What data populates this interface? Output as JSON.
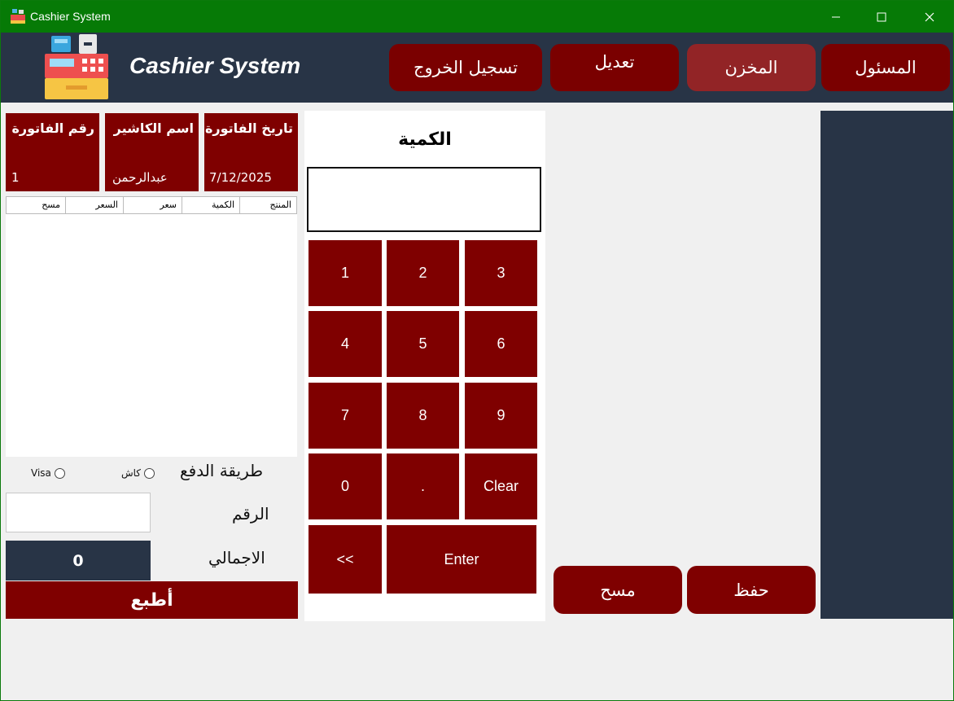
{
  "window": {
    "title": "Cashier System"
  },
  "header": {
    "brand": "Cashier System",
    "nav": [
      {
        "label": "تسجيل الخروج"
      },
      {
        "label": "تعديل"
      },
      {
        "label": "المخزن"
      },
      {
        "label": "المسئول"
      }
    ]
  },
  "invoice": {
    "date_label": "تاريخ الفاتورة",
    "date_value": "7/12/2025",
    "cashier_label": "اسم الكاشير",
    "cashier_value": "عبدالرحمن",
    "number_label": "رقم الفاتورة",
    "number_value": "1"
  },
  "grid": {
    "columns": [
      "المنتج",
      "الكمية",
      "سعر",
      "السعر",
      "مسح"
    ]
  },
  "payment": {
    "method_label": "طريقة الدفع",
    "options": [
      "كاش",
      "Visa"
    ],
    "number_label": "الرقم",
    "total_label": "الاجمالي",
    "total_value": "0",
    "print_label": "أطبع"
  },
  "keypad": {
    "title": "الكمية",
    "keys": [
      "1",
      "2",
      "3",
      "4",
      "5",
      "6",
      "7",
      "8",
      "9",
      "0",
      ".",
      "Clear",
      "<<",
      "Enter"
    ]
  },
  "actions": {
    "clear_label": "مسح",
    "save_label": "حفظ"
  },
  "colors": {
    "titlebar": "#067a06",
    "header": "#283446",
    "accent": "#7f0000",
    "active_nav": "#922426"
  }
}
